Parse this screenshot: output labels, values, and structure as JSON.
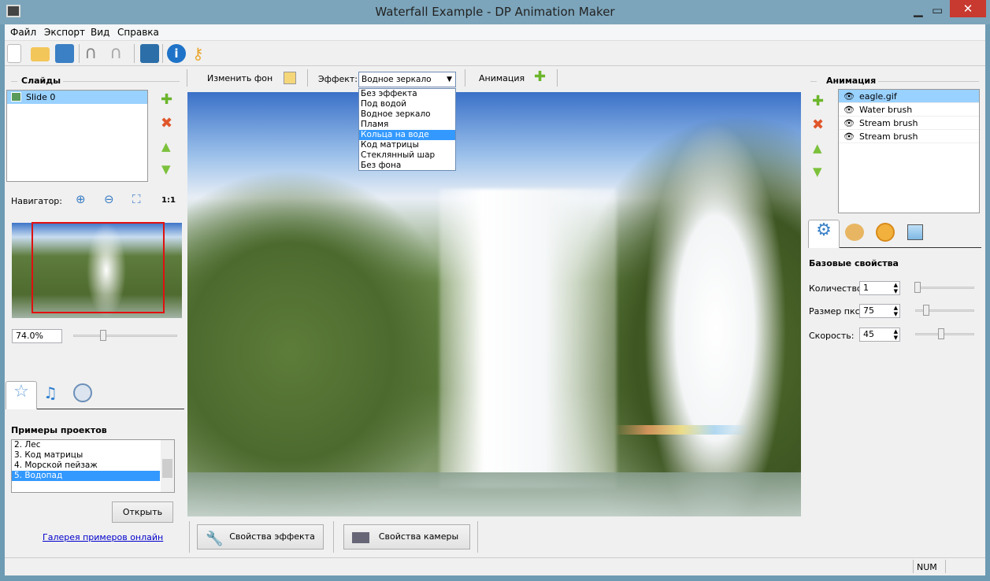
{
  "window": {
    "title": "Waterfall Example - DP Animation Maker"
  },
  "menu": [
    "Файл",
    "Экспорт",
    "Вид",
    "Справка"
  ],
  "toolbar_icons": [
    "new-icon",
    "open-folder-icon",
    "save-icon",
    "undo-icon",
    "redo-icon",
    "export-video-icon",
    "info-icon",
    "key-icon"
  ],
  "slides": {
    "title": "Слайды",
    "items": [
      "Slide 0"
    ]
  },
  "navigator": {
    "label": "Навигатор:",
    "one_to_one": "1:1",
    "zoom": "74.0%"
  },
  "examples": {
    "title": "Примеры проектов",
    "items": [
      "2. Лес",
      "3. Код матрицы",
      "4. Морской пейзаж",
      "5. Водопад"
    ],
    "selected": "5. Водопад",
    "open_label": "Открыть",
    "gallery_link": "Галерея примеров онлайн"
  },
  "topbar": {
    "change_bg": "Изменить фон",
    "effect_label": "Эффект:",
    "effect_value": "Водное зеркало",
    "animation_label": "Анимация"
  },
  "effect_options": [
    "Без эффекта",
    "Под водой",
    "Водное зеркало",
    "Пламя",
    "Кольца на воде",
    "Код матрицы",
    "Стеклянный шар",
    "Без фона"
  ],
  "effect_highlighted": "Кольца на воде",
  "bottom": {
    "effect_props": "Свойства эффекта",
    "camera_props": "Свойства камеры"
  },
  "animation": {
    "title": "Анимация",
    "items": [
      "eagle.gif",
      "Water brush",
      "Stream brush",
      "Stream brush"
    ]
  },
  "properties": {
    "title": "Базовые свойства",
    "fields": [
      {
        "label": "Количество:",
        "value": "1",
        "slider": 0
      },
      {
        "label": "Размер пкс:",
        "value": "75",
        "slider": 0.15
      },
      {
        "label": "Скорость:",
        "value": "45",
        "slider": 0.45
      }
    ]
  },
  "status": {
    "num": "NUM"
  },
  "colors": {
    "selection": "#99d1ff",
    "highlight": "#3399ff",
    "titlebar": "#7ca5bb"
  }
}
